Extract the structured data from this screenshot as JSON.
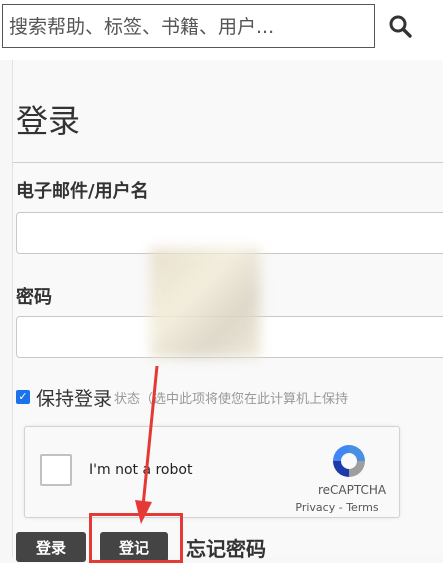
{
  "search": {
    "placeholder": "搜索帮助、标签、书籍、用户..."
  },
  "login": {
    "title": "登录",
    "email_label": "电子邮件/用户名",
    "password_label": "密码",
    "remember_label": "保持登录",
    "remember_hint": "状态（选中此项将使您在此计算机上保持",
    "remember_checked": true
  },
  "recaptcha": {
    "checkbox_label": "I'm not a robot",
    "brand": "reCAPTCHA",
    "links": "Privacy - Terms"
  },
  "buttons": {
    "login": "登录",
    "register": "登记",
    "forgot_password": "忘记密码"
  },
  "colors": {
    "accent": "#1a73e8",
    "button_bg": "#444444",
    "highlight": "#e53935"
  }
}
